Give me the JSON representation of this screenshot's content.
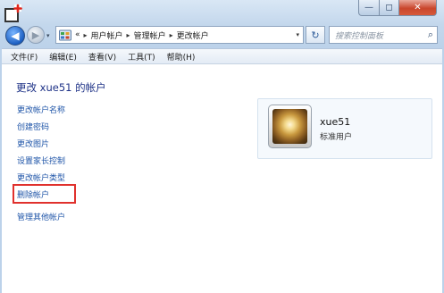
{
  "window": {
    "min_glyph": "—",
    "max_glyph": "◻",
    "close_glyph": "✕"
  },
  "nav": {
    "back_glyph": "◀",
    "forward_glyph": "▶",
    "history_glyph": "▾"
  },
  "address": {
    "prefix": "«",
    "crumbs": [
      "用户帐户",
      "管理帐户",
      "更改帐户"
    ],
    "sep": "▸",
    "dropdown_glyph": "▾"
  },
  "refresh_glyph": "↻",
  "search": {
    "placeholder": "搜索控制面板",
    "icon_glyph": "⌕"
  },
  "menu": [
    "文件(F)",
    "编辑(E)",
    "查看(V)",
    "工具(T)",
    "帮助(H)"
  ],
  "page": {
    "title": "更改 xue51 的帐户",
    "links": [
      "更改帐户名称",
      "创建密码",
      "更改图片",
      "设置家长控制",
      "更改帐户类型",
      "删除帐户",
      "管理其他帐户"
    ]
  },
  "account": {
    "name": "xue51",
    "type": "标准用户"
  },
  "colors": {
    "link": "#1f55a8",
    "title": "#1e3287",
    "highlight": "#e0312d"
  }
}
